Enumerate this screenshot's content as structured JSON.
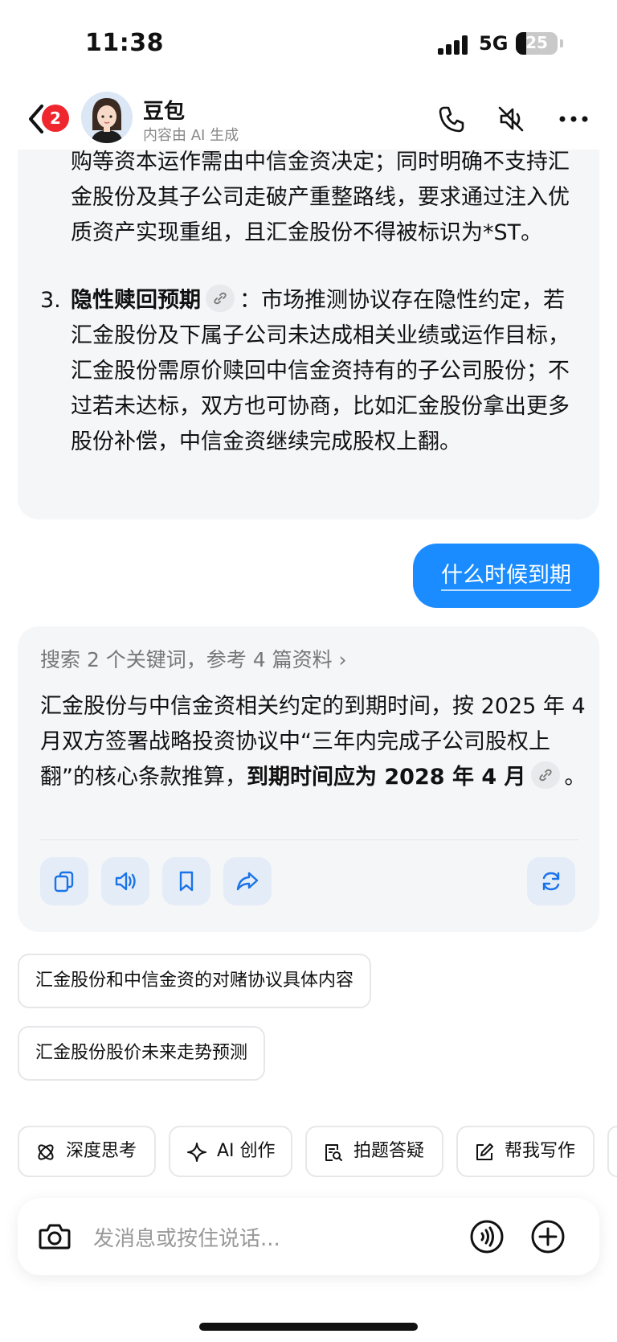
{
  "status": {
    "time": "11:38",
    "network": "5G",
    "battery": "25"
  },
  "header": {
    "badge": "2",
    "name": "豆包",
    "subtitle": "内容由 AI 生成"
  },
  "prev_answer": {
    "p1": "购等资本运作需由中信金资决定；同时明确不支持汇金股份及其子公司走破产重整路线，要求通过注入优质资产实现重组，且汇金股份不得被标识为*ST。",
    "item3_num": "3.",
    "item3_title": "隐性赎回预期",
    "item3_colon": "：",
    "item3_text": "市场推测协议存在隐性约定，若汇金股份及下属子公司未达成相关业绩或运作目标，汇金股份需原价赎回中信金资持有的子公司股份；不过若未达标，双方也可协商，比如汇金股份拿出更多股份补偿，中信金资继续完成股权上翻。"
  },
  "user_message": "什么时候到期",
  "answer": {
    "search_summary": "搜索 2 个关键词，参考 4 篇资料 ›",
    "text_prefix": "汇金股份与中信金资相关约定的到期时间，按 2025 年 4 月双方签署战略投资协议中“三年内完成子公司股权上翻”的核心条款推算，",
    "text_bold": "到期时间应为 2028 年 4 月",
    "text_suffix": "。"
  },
  "suggestions": [
    "汇金股份和中信金资的对赌协议具体内容",
    "汇金股份股价未来走势预测"
  ],
  "tools": [
    "深度思考",
    "AI 创作",
    "拍题答疑",
    "帮我写作"
  ],
  "input": {
    "placeholder": "发消息或按住说话..."
  }
}
